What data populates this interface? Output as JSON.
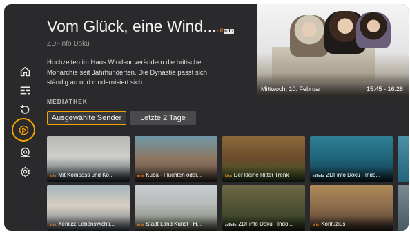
{
  "program": {
    "title": "Vom Glück, eine Wind...",
    "channel_badge": "zdfinfo",
    "channel_badge_prefix": "zdf",
    "channel_badge_suffix": "info",
    "subtitle": "ZDFinfo Doku",
    "description": "Hochzeiten im Haus Windsor verändern die britische Monarchie seit Jahrhunderten. Die Dynastie passt sich ständig an und modernisiert sich."
  },
  "hero": {
    "date": "Mittwoch, 10. Februar",
    "time": "15:45 - 16:28"
  },
  "sidebar": {
    "items": [
      {
        "icon": "home-icon",
        "active": false
      },
      {
        "icon": "guide-icon",
        "active": false
      },
      {
        "icon": "replay-icon",
        "active": false
      },
      {
        "icon": "mediathek-play-icon",
        "active": true
      },
      {
        "icon": "search-icon",
        "active": false
      },
      {
        "icon": "settings-icon",
        "active": false
      }
    ]
  },
  "mediathek": {
    "section_label": "MEDIATHEK",
    "filters": [
      "Ausgewählte Sender",
      "Letzte 2 Tage"
    ],
    "row1": [
      {
        "title": "Mit Kompass und Kö...",
        "logo": "arte"
      },
      {
        "title": "Kuba - Flüchten oder...",
        "logo": "arte"
      },
      {
        "title": "Der kleine Ritter Trenk",
        "logo": "kika"
      },
      {
        "title": "ZDFinfo Doku - Indo...",
        "logo": "zdfinfo"
      },
      {
        "title": "",
        "logo": ""
      }
    ],
    "row2": [
      {
        "title": "Xenius: Lebenswichti...",
        "logo": "arte"
      },
      {
        "title": "Stadt Land Kunst - H...",
        "logo": "arte"
      },
      {
        "title": "ZDFinfo Doku - Indo...",
        "logo": "zdfinfo"
      },
      {
        "title": "Konfuzius",
        "logo": "arte"
      },
      {
        "title": "",
        "logo": ""
      }
    ]
  }
}
